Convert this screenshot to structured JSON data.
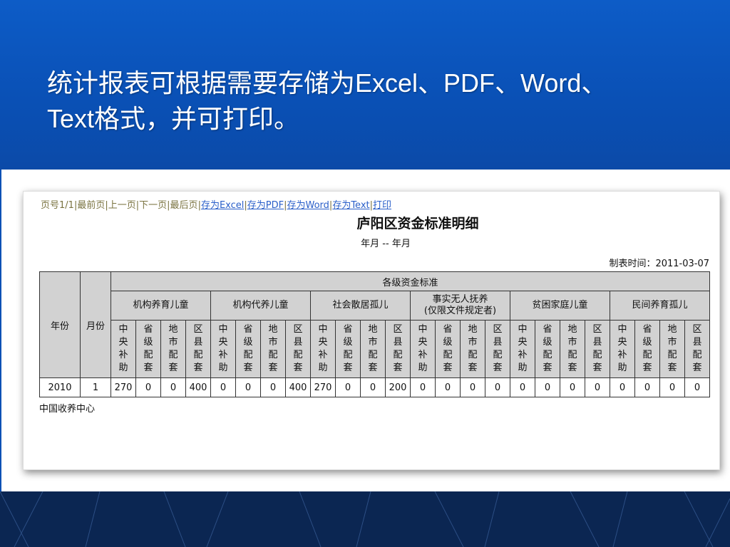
{
  "slide": {
    "headline_line1": "统计报表可根据需要存储为Excel、PDF、Word、",
    "headline_line2": "Text格式，并可打印。"
  },
  "nav": {
    "page": "页号1/1",
    "first": "最前页",
    "prev": "上一页",
    "next": "下一页",
    "last": "最后页",
    "excel": "存为Excel",
    "pdf": "存为PDF",
    "word": "存为Word",
    "text": "存为Text",
    "print": "打印",
    "separator": "|"
  },
  "report": {
    "title": "庐阳区资金标准明细",
    "range": "年月 -- 年月",
    "date_label": "制表时间：2011-03-07",
    "col_year": "年份",
    "col_month": "月份",
    "super_header": "各级资金标准",
    "groups": [
      "机构养育儿童",
      "机构代养儿童",
      "社会散居孤儿",
      "事实无人抚养\n(仅限文件规定者)",
      "贫困家庭儿童",
      "民间养育孤儿"
    ],
    "subcols": [
      "中央补助",
      "省级配套",
      "地市配套",
      "区县配套"
    ],
    "rows": [
      {
        "year": "2010",
        "month": "1",
        "values": [
          "270",
          "0",
          "0",
          "400",
          "0",
          "0",
          "0",
          "400",
          "270",
          "0",
          "0",
          "200",
          "0",
          "0",
          "0",
          "0",
          "0",
          "0",
          "0",
          "0",
          "0",
          "0",
          "0",
          "0"
        ]
      }
    ],
    "footer": "中国收养中心"
  }
}
